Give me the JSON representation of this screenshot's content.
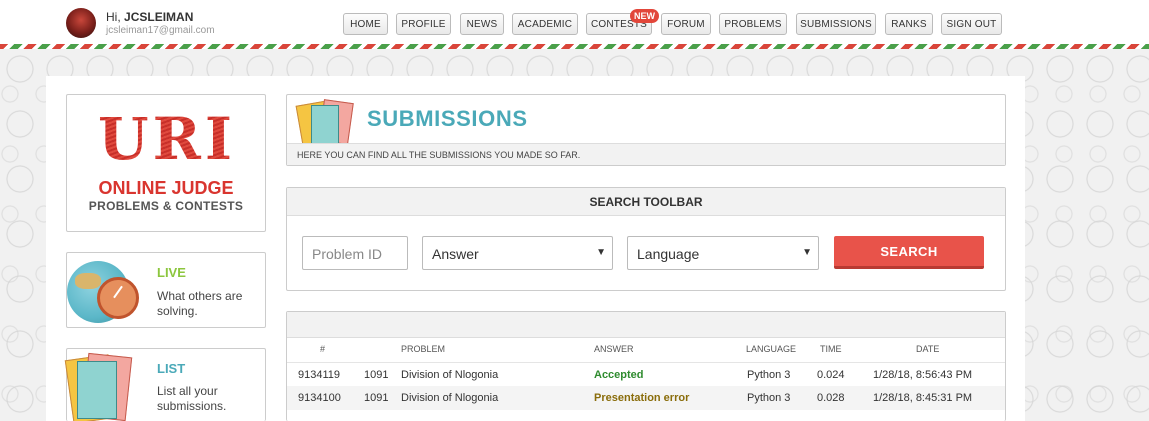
{
  "user": {
    "greeting_prefix": "Hi,",
    "username": "JCSLEIMAN",
    "email": "jcsleiman17@gmail.com"
  },
  "nav": {
    "items": [
      "HOME",
      "PROFILE",
      "NEWS",
      "ACADEMIC",
      "CONTESTS",
      "FORUM",
      "PROBLEMS",
      "SUBMISSIONS",
      "RANKS",
      "SIGN OUT"
    ],
    "badge": "NEW"
  },
  "sidebar": {
    "logo": {
      "title": "URI",
      "line1": "ONLINE JUDGE",
      "line2": "PROBLEMS & CONTESTS"
    },
    "live": {
      "title": "LIVE",
      "desc": "What others are solving.",
      "color": "#8cc63e"
    },
    "list": {
      "title": "LIST",
      "desc": "List all your submissions.",
      "color": "#4aa9b8"
    }
  },
  "page": {
    "title": "SUBMISSIONS",
    "subtitle": "HERE YOU CAN FIND ALL THE SUBMISSIONS YOU MADE SO FAR."
  },
  "search": {
    "heading": "SEARCH TOOLBAR",
    "problem_placeholder": "Problem ID",
    "answer_value": "Answer",
    "language_value": "Language",
    "button": "SEARCH"
  },
  "results": {
    "columns": [
      "#",
      "PROBLEM",
      "ANSWER",
      "LANGUAGE",
      "TIME",
      "DATE"
    ],
    "rows": [
      {
        "id": "9134119",
        "problem_id": "1091",
        "problem": "Division of Nlogonia",
        "answer": "Accepted",
        "language": "Python 3",
        "time": "0.024",
        "date": "1/28/18, 8:56:43 PM"
      },
      {
        "id": "9134100",
        "problem_id": "1091",
        "problem": "Division of Nlogonia",
        "answer": "Presentation error",
        "language": "Python 3",
        "time": "0.028",
        "date": "1/28/18, 8:45:31 PM"
      }
    ]
  },
  "colors": {
    "accent": "#4aa9b8",
    "search_button": "#e8534a",
    "accepted": "#2e8b2e",
    "presentation_error": "#8a6d0b"
  }
}
